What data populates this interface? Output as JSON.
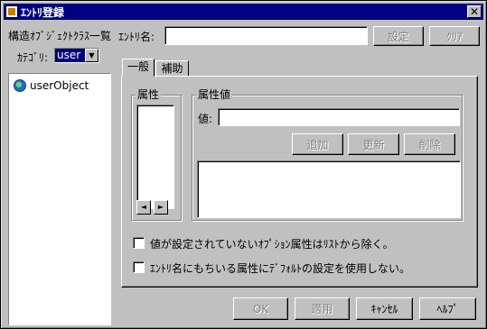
{
  "window": {
    "title": "ｴﾝﾄﾘ登録",
    "close_label": "✕"
  },
  "left": {
    "class_list_label": "構造ｵﾌﾞｼﾞｪｸﾄｸﾗｽ一覧",
    "category_label": "ｶﾃｺﾞﾘ:",
    "category_value": "user",
    "tree_items": [
      {
        "label": "userObject",
        "icon": "globe-icon"
      }
    ]
  },
  "entry": {
    "name_label": "ｴﾝﾄﾘ名:",
    "name_value": "",
    "set_button": "設定",
    "clear_button": "ｸﾘｱ"
  },
  "tabs": [
    {
      "label": "一般",
      "active": true
    },
    {
      "label": "補助",
      "active": false
    }
  ],
  "general": {
    "attr_group": "属性",
    "attr_value_group": "属性値",
    "value_label": "値:",
    "value_text": "",
    "add_button": "追加",
    "update_button": "更新",
    "delete_button": "削除",
    "check_exclude_unset": "値が設定されていないｵﾌﾟｼｮﾝ属性はﾘｽﾄから除く。",
    "check_no_default": "ｴﾝﾄﾘ名にもちいる属性にﾃﾞﾌｫﾙﾄの設定を使用しない。"
  },
  "footer": {
    "ok": "OK",
    "apply": "適用",
    "cancel": "ｷｬﾝｾﾙ",
    "help": "ﾍﾙﾌﾟ"
  },
  "icons": {
    "scroll_left": "◄",
    "scroll_right": "►",
    "dropdown": "▼"
  },
  "colors": {
    "titlebar": "#000080",
    "face": "#c0c0c0"
  }
}
